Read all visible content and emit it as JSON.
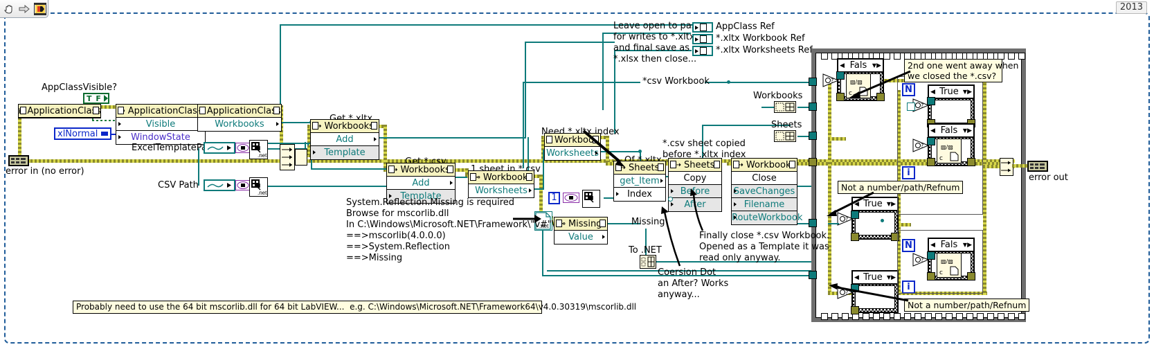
{
  "window": {
    "version_badge": "2013",
    "toolbar": {
      "hand_tool": "hand-tool",
      "arrow_tool": "run-arrow",
      "labview_icon": "labview-vi-icon"
    }
  },
  "controls": {
    "app_class_visible_label": "AppClassVisible?",
    "app_class_visible_value": "T F",
    "window_state_value": "xlNormal",
    "excel_template_path_label": "ExcelTemplatePath",
    "csv_path_label": "CSV Path",
    "error_in_label": "error in (no error)",
    "error_out_label": "error out",
    "sheet_index_value": "1"
  },
  "nodes": {
    "app_class_open": {
      "title": "ApplicationClass",
      "rows": []
    },
    "app_class_props": {
      "title": "ApplicationClass",
      "rows": [
        "Visible",
        "WindowState"
      ]
    },
    "app_class_workbooks": {
      "title": "ApplicationClass",
      "rows": [
        "Workbooks"
      ]
    },
    "get_xltx": {
      "caption": "Get *.xltx",
      "title": "Workbooks",
      "rows": [
        "Add",
        "Template"
      ]
    },
    "get_csv": {
      "caption": "Get *.csv",
      "title": "Workbooks",
      "rows": [
        "Add",
        "Template"
      ]
    },
    "one_sheet_csv": {
      "caption": "1 sheet in *.csv",
      "title": "Workbook",
      "rows": [
        "Worksheets"
      ]
    },
    "need_xltx_index": {
      "caption": "Need *.xltx index",
      "title": "Workbook",
      "rows": [
        "Worksheets"
      ]
    },
    "of_xltx": {
      "caption": "Of *.xltx",
      "title": "Sheets",
      "rows": [
        "get_Item",
        "Index"
      ]
    },
    "sheets_copy": {
      "caption": "*.csv sheet copied\nbefore *.xltx index",
      "title": "Sheets",
      "rows": [
        "Copy",
        "Before",
        "After"
      ]
    },
    "workbook_close": {
      "title": "Workbook",
      "rows": [
        "Close",
        "SaveChanges",
        "Filename",
        "RouteWorkbook"
      ]
    },
    "missing_value": {
      "title": "Missing",
      "rows": [
        "Value"
      ]
    }
  },
  "indicators": {
    "appclass_ref": "AppClass Ref",
    "xltx_workbook_ref": "*.xltx Workbook Ref",
    "xltx_worksheets_ref": "*.xltx Worksheets Ref",
    "csv_workbook": "*csv Workbook",
    "workbooks": "Workbooks",
    "sheets": "Sheets",
    "missing": "Missing",
    "to_net": "To .NET"
  },
  "comments": {
    "leave_open": "Leave open to pass\nfor writes to *.xltx\nand final save as\n*.xlsx then close...",
    "second_one": "2nd one went away when\nwe closed the *.csv?",
    "not_a_number_top": "Not a number/path/Refnum",
    "not_a_number_bottom": "Not a number/path/Refnum",
    "reflection_note": "System.Reflection.Missing is required\nBrowse for mscorlib.dll\nIn C:\\Windows\\Microsoft.NET\\Framework\\\"v#\"\\\n==>mscorlib(4.0.0.0)\n==>System.Reflection\n==>Missing",
    "finally_close": "Finally close *.csv Workbook.\nOpened as a Template it was\nread only anyway.",
    "coercion_dot": "Coersion Dot\nan After? Works\nanyway...",
    "sixty_four_bit": "Probably need to use the 64 bit mscorlib.dll for 64 bit LabVIEW...  e.g. C:\\Windows\\Microsoft.NET\\Framework64\\v4.0.30319\\mscorlib.dll"
  },
  "structures": {
    "case_1_selector": "Fals",
    "case_2_selector": "True",
    "case_3_selector": "Fals",
    "case_4_selector": "True",
    "case_5_selector": "True",
    "case_6_selector": "Fals",
    "loop_count_label": "N",
    "loop_index_label": "i"
  },
  "colors": {
    "wire_teal": "#0d7a7a",
    "error_wire": "#d8d84a",
    "node_header": "#f7f3c0",
    "comment_bg": "#fffde0",
    "blue_accent": "#0b27c9",
    "green_bool": "#0a6b2e",
    "frame_dashed": "#1f5c99"
  }
}
